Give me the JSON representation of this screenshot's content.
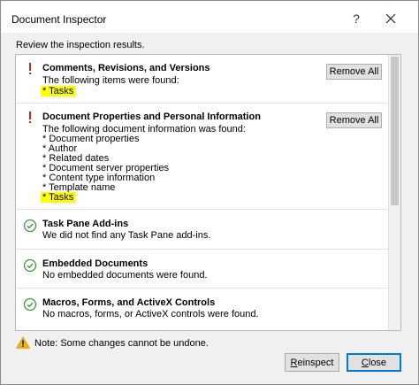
{
  "window": {
    "title": "Document Inspector",
    "help_glyph": "?",
    "subtitle": "Review the inspection results."
  },
  "sections": [
    {
      "status": "issue",
      "icon": "exclamation-icon",
      "title": "Comments, Revisions, and Versions",
      "lines": [
        "The following items were found:",
        "* Tasks"
      ],
      "highlighted_line": "* Tasks",
      "button": "Remove All"
    },
    {
      "status": "issue",
      "icon": "exclamation-icon",
      "title": "Document Properties and Personal Information",
      "lines": [
        "The following document information was found:",
        "* Document properties",
        "* Author",
        "* Related dates",
        "* Document server properties",
        "* Content type information",
        "* Template name",
        "* Tasks"
      ],
      "highlighted_line": "* Tasks",
      "button": "Remove All"
    },
    {
      "status": "ok",
      "icon": "checkmark-circle-icon",
      "title": "Task Pane Add-ins",
      "lines": [
        "We did not find any Task Pane add-ins."
      ]
    },
    {
      "status": "ok",
      "icon": "checkmark-circle-icon",
      "title": "Embedded Documents",
      "lines": [
        "No embedded documents were found."
      ]
    },
    {
      "status": "ok",
      "icon": "checkmark-circle-icon",
      "title": "Macros, Forms, and ActiveX Controls",
      "lines": [
        "No macros, forms, or ActiveX controls were found."
      ]
    }
  ],
  "footer": {
    "note": "Note: Some changes cannot be undone.",
    "reinspect_first": "R",
    "reinspect_rest": "einspect",
    "close_first": "C",
    "close_rest": "lose"
  },
  "colors": {
    "issue": "#c42b1c",
    "ok": "#3c9a3c",
    "highlight": "#ffff00",
    "warning": "#f0b400"
  }
}
